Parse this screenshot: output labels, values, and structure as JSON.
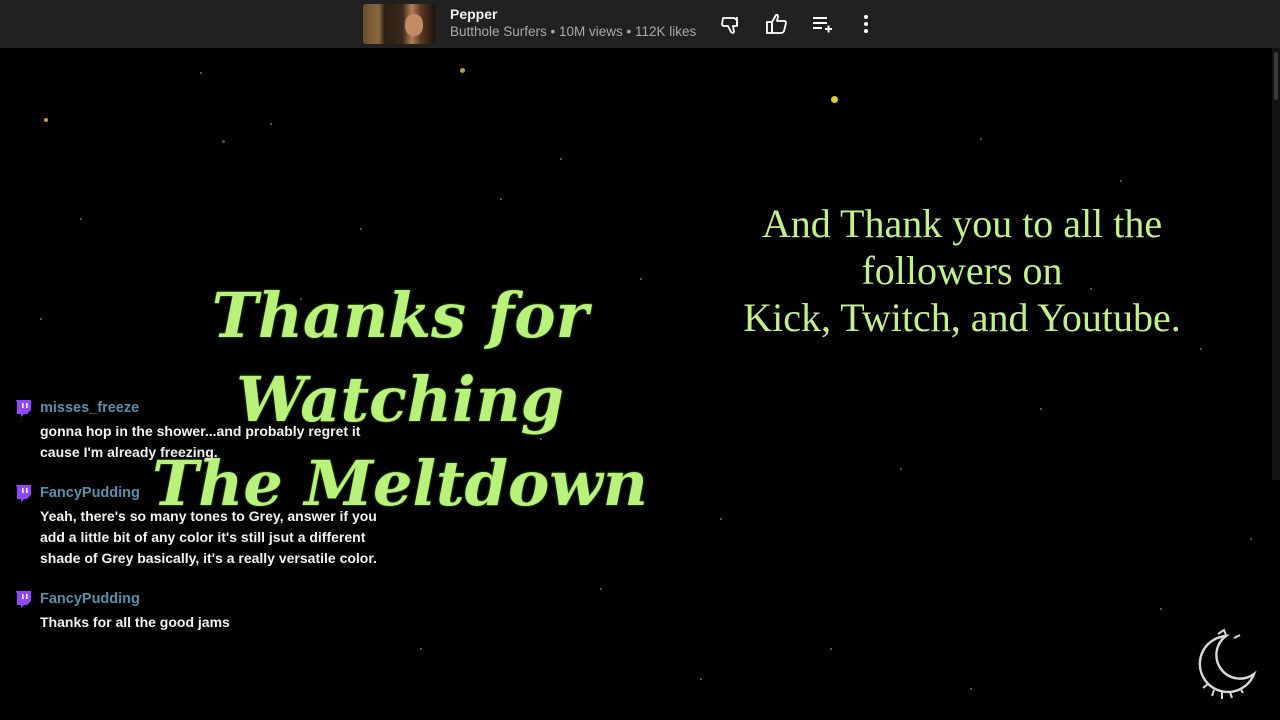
{
  "now_playing": {
    "title": "Pepper",
    "meta": "Butthole Surfers • 10M views • 112K likes",
    "icons": [
      "thumbs-down-icon",
      "thumbs-up-icon",
      "add-to-queue-icon",
      "more-vert-icon"
    ]
  },
  "overlay": {
    "title_line1": "Thanks for Watching",
    "title_line2": "The Meltdown",
    "thanks_line1": "And Thank you to all the",
    "thanks_line2": "followers on",
    "thanks_line3": "Kick, Twitch, and Youtube."
  },
  "chat": {
    "messages": [
      {
        "user": "misses_freeze",
        "text": "gonna hop in the shower...and probably regret it cause I'm already freezing."
      },
      {
        "user": "FancyPudding",
        "text": "Yeah, there's so many tones to Grey, answer if you add a little bit of any color it's still jsut a different shade of Grey basically, it's a really versatile color."
      },
      {
        "user": "FancyPudding",
        "text": "Thanks for all the good jams"
      }
    ]
  },
  "colors": {
    "title_green": "#b8f27a",
    "username_blue": "#5b8fa8",
    "twitch_purple": "#9146ff",
    "bar_bg": "#212121"
  }
}
